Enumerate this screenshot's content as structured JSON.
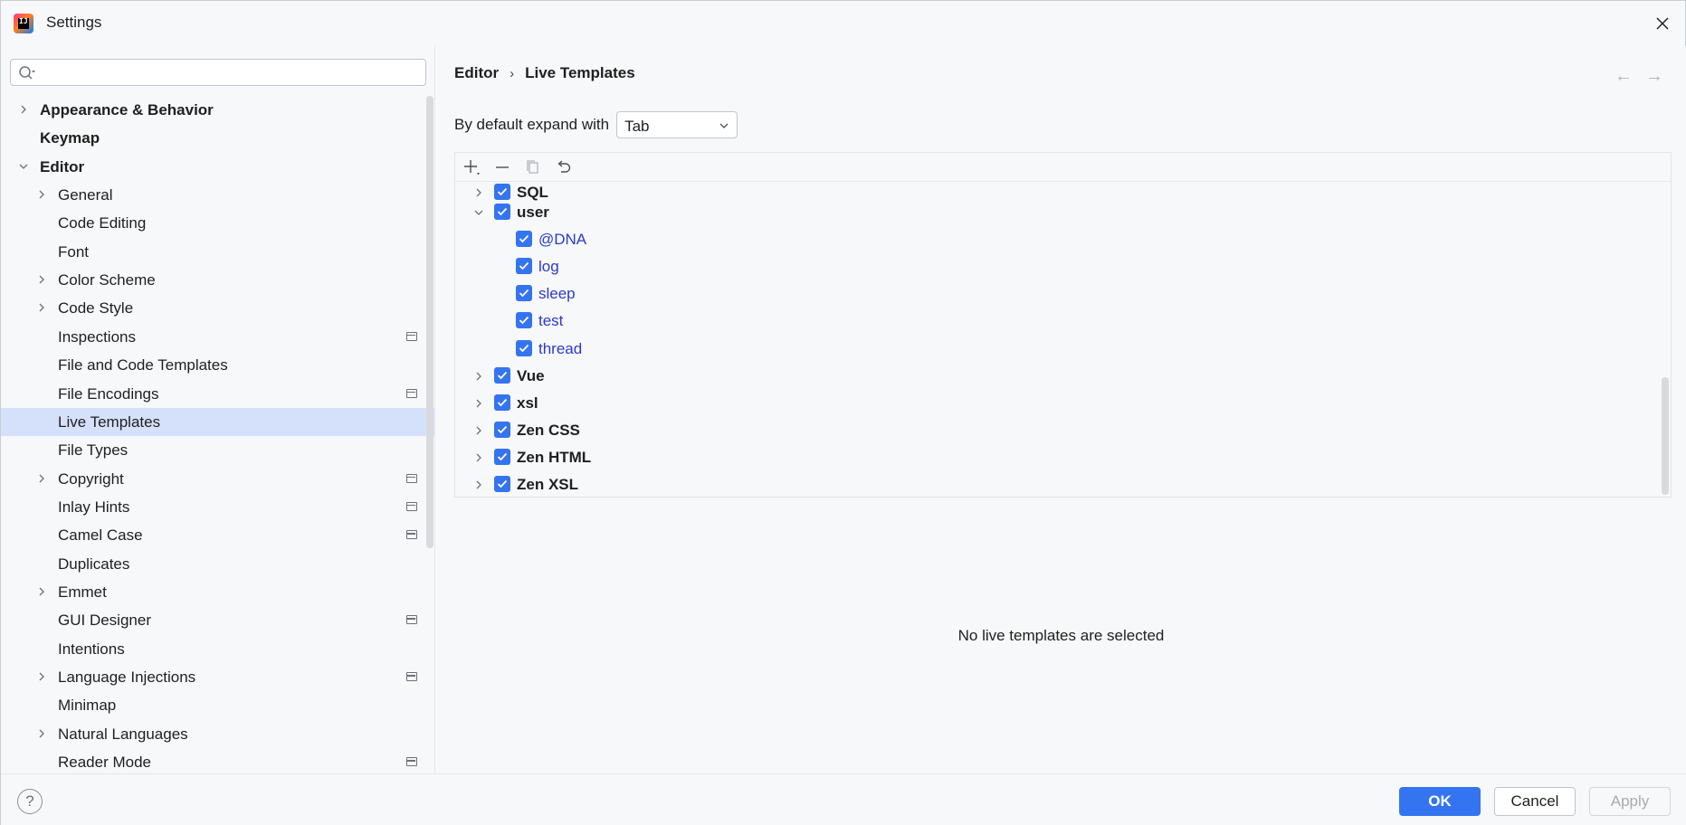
{
  "window": {
    "title": "Settings"
  },
  "search": {
    "placeholder": ""
  },
  "sidebar": {
    "items": [
      {
        "label": "Appearance & Behavior",
        "bold": true,
        "level": 0,
        "expandable": true,
        "expanded": false,
        "badge": false,
        "selected": false
      },
      {
        "label": "Keymap",
        "bold": true,
        "level": 0,
        "expandable": false,
        "expanded": false,
        "badge": false,
        "selected": false
      },
      {
        "label": "Editor",
        "bold": true,
        "level": 0,
        "expandable": true,
        "expanded": true,
        "badge": false,
        "selected": false
      },
      {
        "label": "General",
        "bold": false,
        "level": 1,
        "expandable": true,
        "expanded": false,
        "badge": false,
        "selected": false
      },
      {
        "label": "Code Editing",
        "bold": false,
        "level": 1,
        "expandable": false,
        "expanded": false,
        "badge": false,
        "selected": false
      },
      {
        "label": "Font",
        "bold": false,
        "level": 1,
        "expandable": false,
        "expanded": false,
        "badge": false,
        "selected": false
      },
      {
        "label": "Color Scheme",
        "bold": false,
        "level": 1,
        "expandable": true,
        "expanded": false,
        "badge": false,
        "selected": false
      },
      {
        "label": "Code Style",
        "bold": false,
        "level": 1,
        "expandable": true,
        "expanded": false,
        "badge": false,
        "selected": false
      },
      {
        "label": "Inspections",
        "bold": false,
        "level": 1,
        "expandable": false,
        "expanded": false,
        "badge": true,
        "selected": false
      },
      {
        "label": "File and Code Templates",
        "bold": false,
        "level": 1,
        "expandable": false,
        "expanded": false,
        "badge": false,
        "selected": false
      },
      {
        "label": "File Encodings",
        "bold": false,
        "level": 1,
        "expandable": false,
        "expanded": false,
        "badge": true,
        "selected": false
      },
      {
        "label": "Live Templates",
        "bold": false,
        "level": 1,
        "expandable": false,
        "expanded": false,
        "badge": false,
        "selected": true
      },
      {
        "label": "File Types",
        "bold": false,
        "level": 1,
        "expandable": false,
        "expanded": false,
        "badge": false,
        "selected": false
      },
      {
        "label": "Copyright",
        "bold": false,
        "level": 1,
        "expandable": true,
        "expanded": false,
        "badge": true,
        "selected": false
      },
      {
        "label": "Inlay Hints",
        "bold": false,
        "level": 1,
        "expandable": false,
        "expanded": false,
        "badge": true,
        "selected": false
      },
      {
        "label": "Camel Case",
        "bold": false,
        "level": 1,
        "expandable": false,
        "expanded": false,
        "badge": true,
        "selected": false
      },
      {
        "label": "Duplicates",
        "bold": false,
        "level": 1,
        "expandable": false,
        "expanded": false,
        "badge": false,
        "selected": false
      },
      {
        "label": "Emmet",
        "bold": false,
        "level": 1,
        "expandable": true,
        "expanded": false,
        "badge": false,
        "selected": false
      },
      {
        "label": "GUI Designer",
        "bold": false,
        "level": 1,
        "expandable": false,
        "expanded": false,
        "badge": true,
        "selected": false
      },
      {
        "label": "Intentions",
        "bold": false,
        "level": 1,
        "expandable": false,
        "expanded": false,
        "badge": false,
        "selected": false
      },
      {
        "label": "Language Injections",
        "bold": false,
        "level": 1,
        "expandable": true,
        "expanded": false,
        "badge": true,
        "selected": false
      },
      {
        "label": "Minimap",
        "bold": false,
        "level": 1,
        "expandable": false,
        "expanded": false,
        "badge": false,
        "selected": false
      },
      {
        "label": "Natural Languages",
        "bold": false,
        "level": 1,
        "expandable": true,
        "expanded": false,
        "badge": false,
        "selected": false
      },
      {
        "label": "Reader Mode",
        "bold": false,
        "level": 1,
        "expandable": false,
        "expanded": false,
        "badge": true,
        "selected": false
      }
    ]
  },
  "breadcrumb": {
    "parent": "Editor",
    "separator": "›",
    "current": "Live Templates"
  },
  "nav": {
    "back": "←",
    "forward": "→"
  },
  "expand_with": {
    "label": "By default expand with",
    "value": "Tab"
  },
  "templates": {
    "rows": [
      {
        "label": "SQL",
        "type": "group",
        "checked": true,
        "expanded": false,
        "partial": true
      },
      {
        "label": "user",
        "type": "group",
        "checked": true,
        "expanded": true,
        "partial": false
      },
      {
        "label": "@DNA",
        "type": "template",
        "checked": true
      },
      {
        "label": "log",
        "type": "template",
        "checked": true
      },
      {
        "label": "sleep",
        "type": "template",
        "checked": true
      },
      {
        "label": "test",
        "type": "template",
        "checked": true
      },
      {
        "label": "thread",
        "type": "template",
        "checked": true
      },
      {
        "label": "Vue",
        "type": "group",
        "checked": true,
        "expanded": false
      },
      {
        "label": "xsl",
        "type": "group",
        "checked": true,
        "expanded": false
      },
      {
        "label": "Zen CSS",
        "type": "group",
        "checked": true,
        "expanded": false
      },
      {
        "label": "Zen HTML",
        "type": "group",
        "checked": true,
        "expanded": false
      },
      {
        "label": "Zen XSL",
        "type": "group",
        "checked": true,
        "expanded": false
      }
    ]
  },
  "empty_message": "No live templates are selected",
  "footer": {
    "help": "?",
    "ok": "OK",
    "cancel": "Cancel",
    "apply": "Apply"
  },
  "colors": {
    "accent": "#3574f0",
    "selection": "#d5e1fb",
    "template_link": "#2c39c8"
  }
}
